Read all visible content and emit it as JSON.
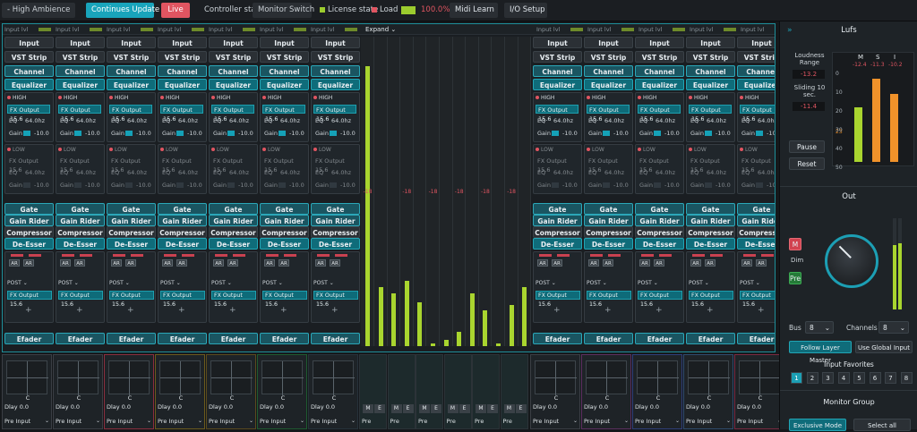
{
  "top": {
    "preset": "- High Ambience",
    "continues": "Continues Update",
    "live": "Live",
    "controller_state": "Controller state",
    "monitor_switch": "Monitor Switch",
    "license": "License state",
    "load": "Load",
    "load_pct": "100.0%",
    "midi": "Midi Learn",
    "io": "I/O Setup"
  },
  "mixer": {
    "input_lvl": "Input lvl",
    "expand": "Expand ⌄",
    "buttons": {
      "input": "Input",
      "vst": "VST Strip",
      "channel": "Channel Strip",
      "equalizer": "Equalizer",
      "gate": "Gate",
      "gain_rider": "Gain Rider",
      "compressor": "Compressor",
      "deesser": "De-Esser",
      "efader": "Efader"
    },
    "eq": {
      "high": "HIGH",
      "low": "LOW",
      "fx": "FX Output 15.6",
      "eq": "EQ",
      "freq": "64.0hz",
      "gain": "Gain",
      "gain_val": "-10.0"
    },
    "ar": "AR",
    "post": "POST ⌄",
    "fx_output": "FX Output 15.6",
    "plus": "+",
    "meter_label": "-18",
    "meter_levels": [
      0.95,
      0.2,
      0.18,
      0.22,
      0.15,
      0.01,
      0.02,
      0.05,
      0.18,
      0.12,
      0.01,
      0.14,
      0.2
    ],
    "pan_label": "C",
    "dly": "Dlay  0.0",
    "pre_input": "Pre Input",
    "pre": "Pre",
    "m": "M",
    "e": "E"
  },
  "lufs": {
    "title": "Lufs",
    "loud": "Loudness Range",
    "loud_val": "-13.2",
    "sliding": "Sliding 10 sec.",
    "sliding_val": "-11.4",
    "m": "M",
    "s": "S",
    "i": "I",
    "m_val": "-12.4",
    "s_val": "-11.3",
    "i_val": "-10.2",
    "scale": [
      "0",
      "10",
      "20",
      "23",
      "30",
      "40",
      "50"
    ],
    "pause": "Pause",
    "reset": "Reset",
    "levels": [
      0.58,
      0.88,
      0.72
    ]
  },
  "out": {
    "title": "Out",
    "m": "M",
    "dim": "Dim",
    "pre": "Pre",
    "bus_label": "Bus",
    "bus": "8",
    "channels_label": "Channels",
    "channels": "8",
    "follow": "Follow Layer Master",
    "global": "Use Global Input",
    "favorites": "Input Favorites",
    "nums": [
      "1",
      "2",
      "3",
      "4",
      "5",
      "6",
      "7",
      "8"
    ],
    "monitor_group": "Monitor Group",
    "exclusive": "Exclusive Mode",
    "select_all": "Select all"
  }
}
